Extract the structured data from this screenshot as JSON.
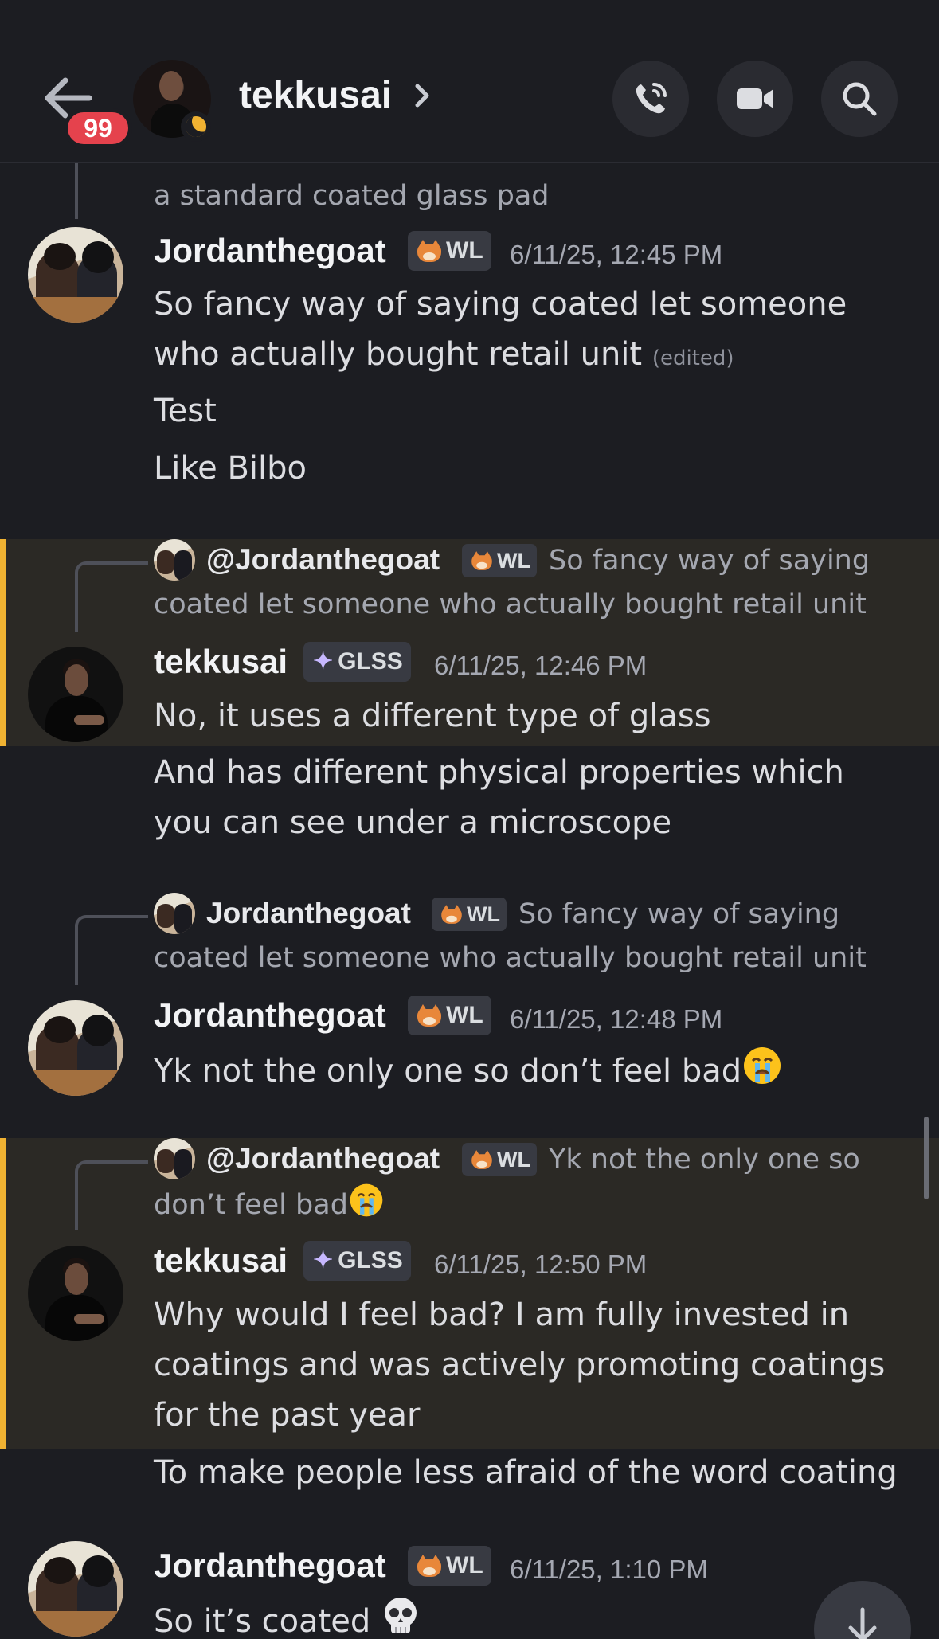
{
  "header": {
    "back_badge": "99",
    "channel_name": "tekkusai",
    "icons": [
      "back-arrow-icon",
      "chevron-right-icon",
      "phone-icon",
      "video-camera-icon",
      "search-icon"
    ]
  },
  "messages": [
    {
      "reply_tail": "a standard coated glass pad"
    },
    {
      "author": "Jordanthegoat",
      "tag": "WL",
      "time": "6/11/25, 12:45 PM",
      "lines": [
        "So fancy way of saying coated  let someone",
        "who actually bought retail unit"
      ],
      "edited": "(edited)",
      "followups": [
        "Test",
        "Like Bilbo"
      ]
    },
    {
      "highlighted": true,
      "reply": {
        "name": "@Jordanthegoat",
        "tag": "WL",
        "text_1": "So fancy way of saying",
        "text_2": "coated  let someone who actually bought retail unit"
      },
      "author": "tekkusai",
      "tag": "GLSS",
      "time": "6/11/25, 12:46 PM",
      "lines": [
        "No, it uses a different type of glass"
      ],
      "followups": [
        "And has different physical properties which",
        "you can see under a microscope"
      ]
    },
    {
      "reply": {
        "name": "Jordanthegoat",
        "tag": "WL",
        "text_1": "So fancy way of saying",
        "text_2": "coated  let someone who actually bought retail unit"
      },
      "author": "Jordanthegoat",
      "tag": "WL",
      "time": "6/11/25, 12:48 PM",
      "lines": [
        "Yk not the only one so don’t feel bad"
      ]
    },
    {
      "highlighted": true,
      "reply": {
        "name": "@Jordanthegoat",
        "tag": "WL",
        "text_1": "Yk not the only one so",
        "text_2": "don’t feel bad"
      },
      "author": "tekkusai",
      "tag": "GLSS",
      "time": "6/11/25, 12:50 PM",
      "lines": [
        "Why would I feel bad? I am fully invested in",
        "coatings and was actively promoting coatings",
        "for the past year"
      ],
      "followups": [
        "To make people less afraid of the word coating"
      ]
    },
    {
      "author": "Jordanthegoat",
      "tag": "WL",
      "time": "6/11/25, 1:10 PM",
      "lines": [
        "So it’s coated "
      ]
    }
  ],
  "colors": {
    "background": "#1c1d22",
    "highlight_bg": "#2b2925",
    "highlight_bar": "#f0b232",
    "badge_red": "#e5424d"
  }
}
